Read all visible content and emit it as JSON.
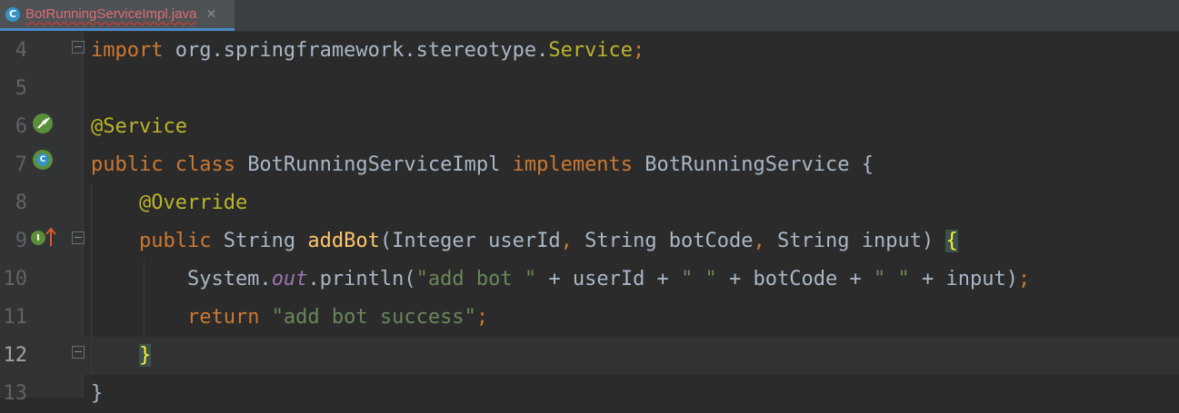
{
  "tab": {
    "label": "BotRunningServiceImpl.java",
    "icon_letter": "C",
    "close": "✕"
  },
  "lines": [
    {
      "num": "4",
      "tokens": [
        [
          "kw",
          "import"
        ],
        [
          "p",
          " org.springframework.stereotype."
        ],
        [
          "ann",
          "Service"
        ],
        [
          "kw",
          ";"
        ]
      ]
    },
    {
      "num": "5",
      "tokens": []
    },
    {
      "num": "6",
      "tokens": [
        [
          "ann",
          "@Service"
        ]
      ]
    },
    {
      "num": "7",
      "tokens": [
        [
          "kw",
          "public class "
        ],
        [
          "p",
          "BotRunningServiceImpl "
        ],
        [
          "kw",
          "implements "
        ],
        [
          "p",
          "BotRunningService {"
        ]
      ]
    },
    {
      "num": "8",
      "tokens": [
        [
          "p",
          "    "
        ],
        [
          "ann",
          "@Override"
        ]
      ]
    },
    {
      "num": "9",
      "tokens": [
        [
          "p",
          "    "
        ],
        [
          "kw",
          "public "
        ],
        [
          "p",
          "String "
        ],
        [
          "fn",
          "addBot"
        ],
        [
          "p",
          "(Integer userId"
        ],
        [
          "kw",
          ", "
        ],
        [
          "p",
          "String botCode"
        ],
        [
          "kw",
          ", "
        ],
        [
          "p",
          "String input) "
        ],
        [
          "brace-hl",
          "{"
        ]
      ]
    },
    {
      "num": "10",
      "tokens": [
        [
          "p",
          "        System."
        ],
        [
          "fld",
          "out"
        ],
        [
          "p",
          ".println("
        ],
        [
          "str",
          "\"add bot \""
        ],
        [
          "p",
          " + userId + "
        ],
        [
          "str",
          "\" \""
        ],
        [
          "p",
          " + botCode + "
        ],
        [
          "str",
          "\" \""
        ],
        [
          "p",
          " + input)"
        ],
        [
          "kw",
          ";"
        ]
      ]
    },
    {
      "num": "11",
      "tokens": [
        [
          "p",
          "        "
        ],
        [
          "kw",
          "return "
        ],
        [
          "str",
          "\"add bot success\""
        ],
        [
          "kw",
          ";"
        ]
      ]
    },
    {
      "num": "12",
      "tokens": [
        [
          "p",
          "    "
        ],
        [
          "brace-hl",
          "}"
        ]
      ]
    },
    {
      "num": "13",
      "tokens": [
        [
          "p",
          "}"
        ]
      ]
    }
  ],
  "current_line": "12",
  "gutter_icons": {
    "line6": "spring-bean-icon",
    "line7": "spring-bean-implement-icon",
    "line9": "implements-method-icon",
    "line9_letter": "I",
    "line7_letter": "C"
  },
  "colors": {
    "background": "#2b2b2b",
    "keyword": "#cc7832",
    "annotation": "#bbb529",
    "string": "#6a8759",
    "method": "#ffc66d"
  }
}
